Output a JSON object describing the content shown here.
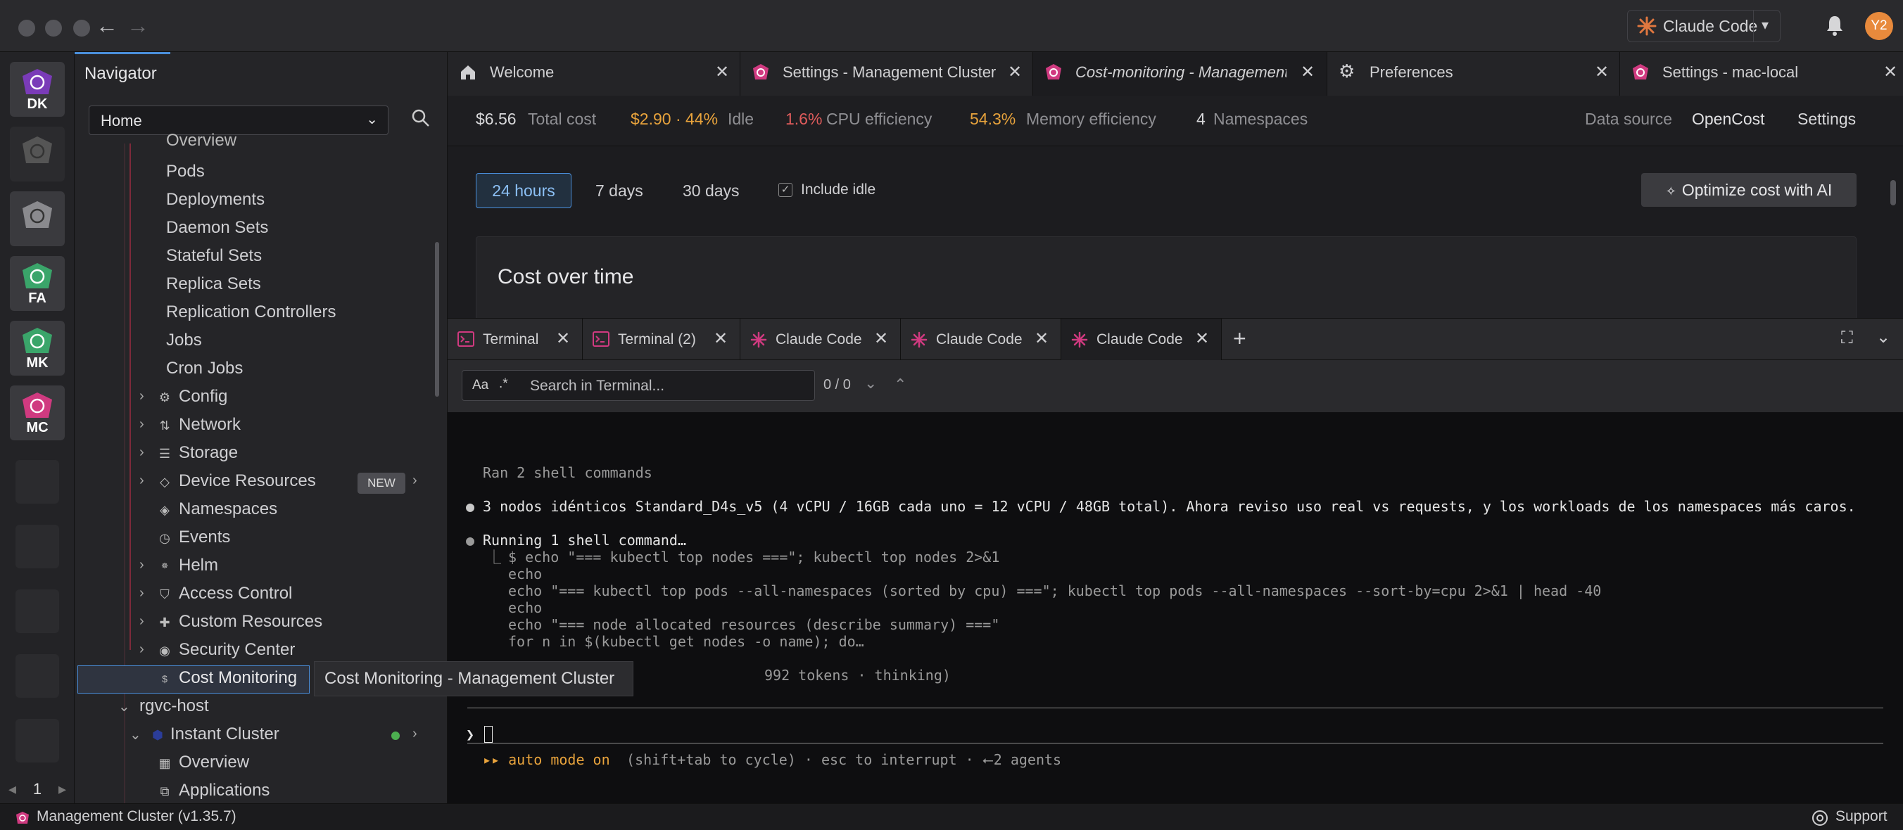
{
  "user": {
    "initials": "Y2"
  },
  "header": {
    "claude_code_label": "Claude Code"
  },
  "hotbar": {
    "items": [
      {
        "label": "DK",
        "color": "#7a3bb8"
      },
      {
        "label": "",
        "color": "#555"
      },
      {
        "label": "",
        "color": "#777"
      },
      {
        "label": "FA",
        "color": "#3aa56a"
      },
      {
        "label": "MK",
        "color": "#3aa56a"
      },
      {
        "label": "MC",
        "color": "#d03a80"
      }
    ],
    "page": "1"
  },
  "navigator": {
    "title": "Navigator",
    "select_value": "Home",
    "workloads": [
      "Overview",
      "Pods",
      "Deployments",
      "Daemon Sets",
      "Stateful Sets",
      "Replica Sets",
      "Replication Controllers",
      "Jobs",
      "Cron Jobs"
    ],
    "sections": [
      "Config",
      "Network",
      "Storage",
      "Device Resources",
      "Namespaces",
      "Events",
      "Helm",
      "Access Control",
      "Custom Resources",
      "Security Center",
      "Cost Monitoring"
    ],
    "new_badge": "NEW",
    "cluster2": "rgvc-host",
    "cluster2_child": "Instant Cluster",
    "cluster2_items": [
      "Overview",
      "Applications"
    ],
    "tooltip": "Cost Monitoring - Management Cluster"
  },
  "tabs": [
    {
      "label": "Welcome"
    },
    {
      "label": "Settings - Management Cluster"
    },
    {
      "label": "Cost-monitoring - Management..."
    },
    {
      "label": "Preferences"
    },
    {
      "label": "Settings - mac-local"
    }
  ],
  "cost": {
    "total_value": "$6.56",
    "total_label": "Total cost",
    "idle_value": "$2.90 · 44%",
    "idle_label": "Idle",
    "cpu_value": "1.6%",
    "cpu_label": "CPU efficiency",
    "mem_value": "54.3%",
    "mem_label": "Memory efficiency",
    "ns_value": "4",
    "ns_label": "Namespaces",
    "datasource_label": "Data source",
    "datasource_value": "OpenCost",
    "settings_label": "Settings",
    "colors": {
      "idle": "#e8a33c",
      "cpu": "#e05c5c",
      "mem": "#e8a33c"
    }
  },
  "controls": {
    "ranges": [
      "24 hours",
      "7 days",
      "30 days"
    ],
    "include_idle": "Include idle",
    "optimize": "Optimize cost with AI",
    "card_title": "Cost over time"
  },
  "dock": {
    "tabs": [
      "Terminal",
      "Terminal (2)",
      "Claude Code",
      "Claude Code",
      "Claude Code"
    ],
    "search_placeholder": "Search in Terminal...",
    "search_aa": "Aa",
    "search_regex": ".*",
    "search_count": "0 / 0"
  },
  "terminal": {
    "l1": "Ran 2 shell commands",
    "l2": "3 nodos idénticos Standard_D4s_v5 (4 vCPU / 16GB cada uno = 12 vCPU / 48GB total). Ahora reviso uso real vs requests, y los workloads de los namespaces más caros.",
    "l3": "Running 1 shell command…",
    "c1": "$ echo \"=== kubectl top nodes ===\"; kubectl top nodes 2>&1",
    "c2": "echo",
    "c3": "echo \"=== kubectl top pods --all-namespaces (sorted by cpu) ===\"; kubectl top pods --all-namespaces --sort-by=cpu 2>&1 | head -40",
    "c4": "echo",
    "c5": "echo \"=== node allocated resources (describe summary) ===\"",
    "c6": "for n in $(kubectl get nodes -o name); do…",
    "c7": "992 tokens · thinking)",
    "prompt": "❯",
    "mode_on": "▸▸ auto mode on",
    "mode_rest": " (shift+tab to cycle) · esc to interrupt · ⭠2 agents"
  },
  "status": {
    "cluster": "Management Cluster (v1.35.7)",
    "support": "Support"
  }
}
